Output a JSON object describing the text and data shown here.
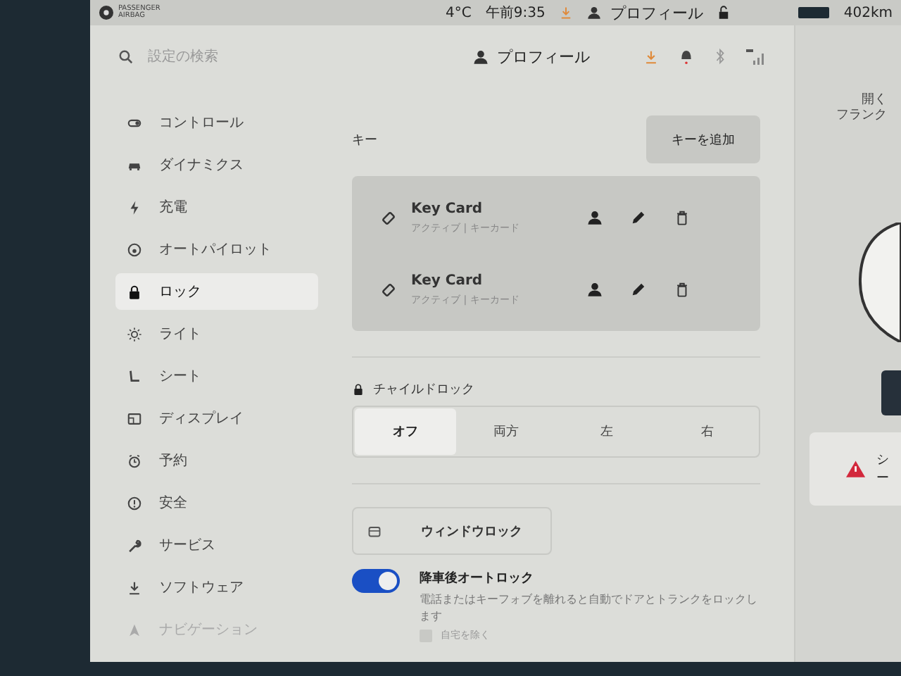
{
  "status_bar": {
    "airbag_label": "PASSENGER AIRBAG",
    "temperature": "4°C",
    "time": "午前9:35",
    "profile": "プロフィール",
    "range": "402km"
  },
  "header": {
    "search": {
      "placeholder": "設定の検索"
    },
    "profile": "プロフィール"
  },
  "sidebar": {
    "items": [
      {
        "label": "コントロール",
        "kind": "toggle",
        "selected": false
      },
      {
        "label": "ダイナミクス",
        "kind": "car",
        "selected": false
      },
      {
        "label": "充電",
        "kind": "bolt",
        "selected": false
      },
      {
        "label": "オートパイロット",
        "kind": "wheel",
        "selected": false
      },
      {
        "label": "ロック",
        "kind": "lock",
        "selected": true
      },
      {
        "label": "ライト",
        "kind": "sun",
        "selected": false
      },
      {
        "label": "シート",
        "kind": "seat",
        "selected": false
      },
      {
        "label": "ディスプレイ",
        "kind": "display",
        "selected": false
      },
      {
        "label": "予約",
        "kind": "clock",
        "selected": false
      },
      {
        "label": "安全",
        "kind": "info",
        "selected": false
      },
      {
        "label": "サービス",
        "kind": "wrench",
        "selected": false
      },
      {
        "label": "ソフトウェア",
        "kind": "download",
        "selected": false
      },
      {
        "label": "ナビゲーション",
        "kind": "nav",
        "selected": false
      }
    ]
  },
  "keys": {
    "title": "キー",
    "add_button": "キーを追加",
    "items": [
      {
        "name": "Key Card",
        "detail": "アクティブ | キーカード"
      },
      {
        "name": "Key Card",
        "detail": "アクティブ | キーカード"
      }
    ]
  },
  "child_lock": {
    "title": "チャイルドロック",
    "options": [
      {
        "label": "オフ",
        "selected": true
      },
      {
        "label": "両方",
        "selected": false
      },
      {
        "label": "左",
        "selected": false
      },
      {
        "label": "右",
        "selected": false
      }
    ]
  },
  "window_lock": {
    "label": "ウィンドウロック"
  },
  "walk_away_lock": {
    "label": "降車後オートロック",
    "description": "電話またはキーフォブを離れると自動でドアとトランクをロックします",
    "on": true
  },
  "exclude_home": {
    "label": "自宅を除く",
    "checked": false
  },
  "car_panel": {
    "frunk_action": "開く",
    "frunk_label": "フランク",
    "alert": "シー"
  }
}
